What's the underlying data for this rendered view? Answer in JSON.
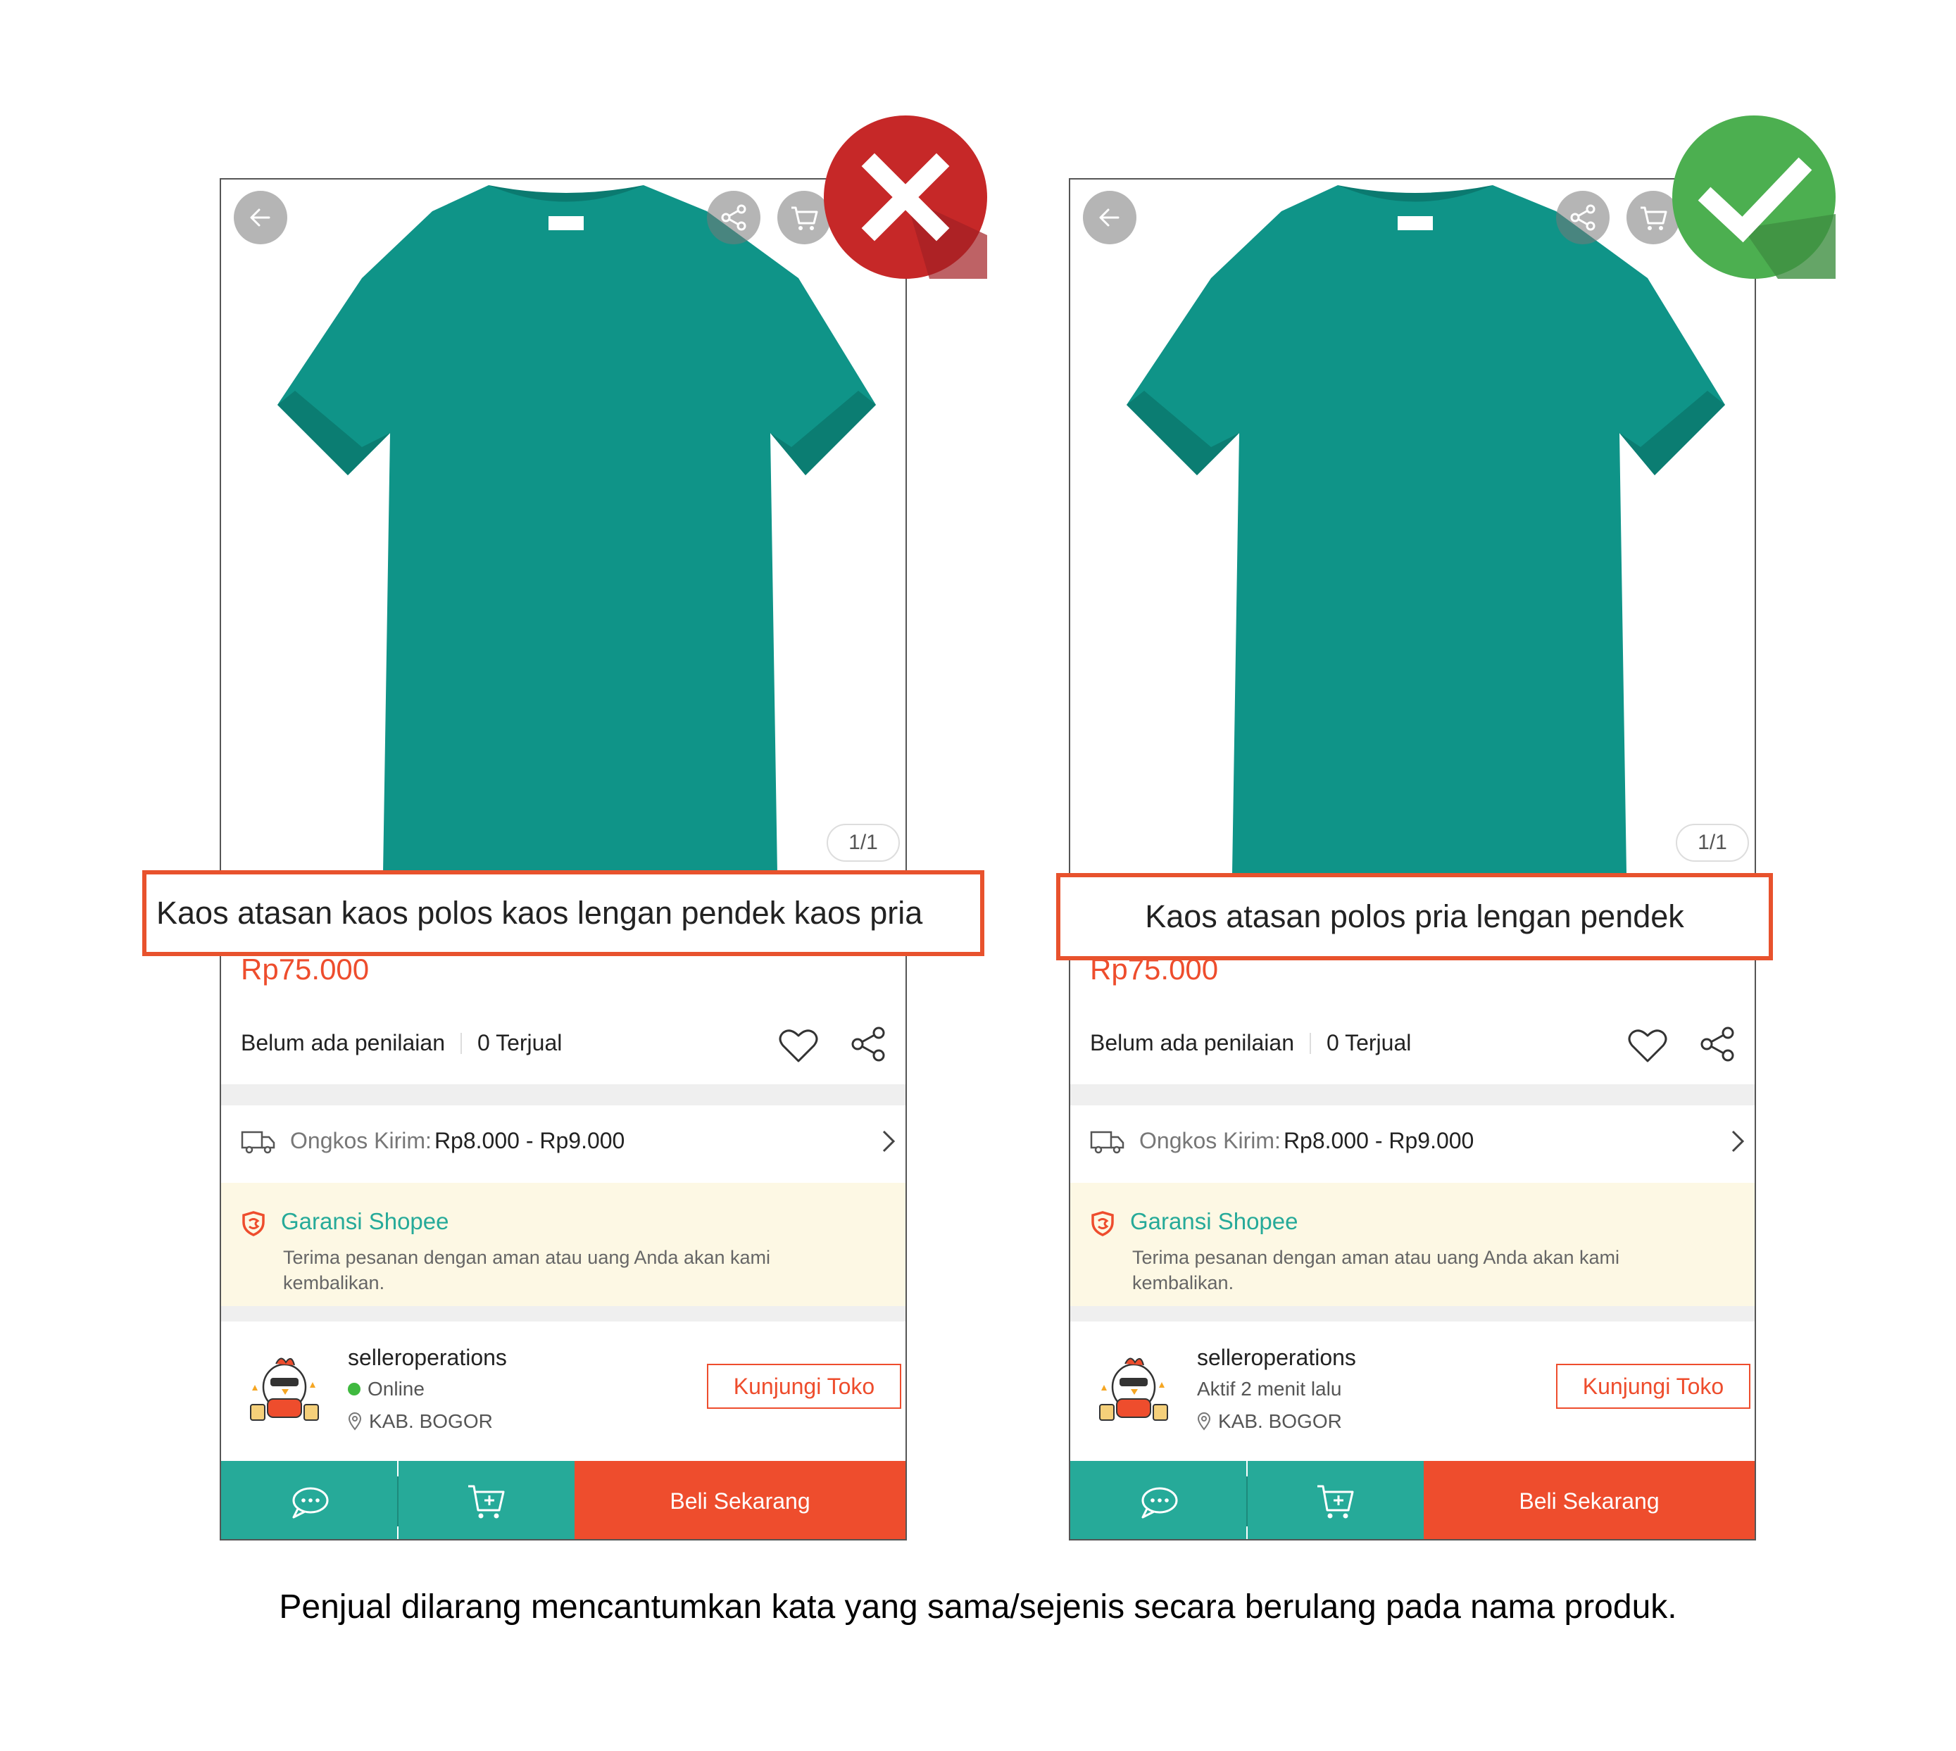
{
  "panels": [
    {
      "verdict": "wrong",
      "image_counter": "1/1",
      "product_title": "Kaos atasan kaos polos kaos lengan pendek kaos pria",
      "price": "Rp75.000",
      "rating_text": "Belum ada penilaian",
      "sold_text": "0 Terjual",
      "shipping_label": "Ongkos Kirim:",
      "shipping_value": "Rp8.000 - Rp9.000",
      "guarantee_title": "Garansi Shopee",
      "guarantee_text": "Terima pesanan dengan aman atau uang Anda akan kami kembalikan.",
      "shop_name": "selleroperations",
      "shop_status": "Online",
      "shop_location": "KAB. BOGOR",
      "visit_button": "Kunjungi Toko",
      "buy_button": "Beli Sekarang"
    },
    {
      "verdict": "correct",
      "image_counter": "1/1",
      "product_title": "Kaos atasan polos pria lengan pendek",
      "price": "Rp75.000",
      "rating_text": "Belum ada penilaian",
      "sold_text": "0 Terjual",
      "shipping_label": "Ongkos Kirim:",
      "shipping_value": "Rp8.000 - Rp9.000",
      "guarantee_title": "Garansi Shopee",
      "guarantee_text": "Terima pesanan dengan aman atau uang Anda akan kami kembalikan.",
      "shop_name": "selleroperations",
      "shop_status": "Aktif 2 menit lalu",
      "shop_location": "KAB. BOGOR",
      "visit_button": "Kunjungi Toko",
      "buy_button": "Beli Sekarang"
    }
  ],
  "caption": "Penjual dilarang mencantumkan kata yang sama/sejenis secara berulang pada nama produk.",
  "colors": {
    "accent_orange": "#ee4d2d",
    "teal": "#26aa99",
    "shirt": "#0f9488",
    "wrong_badge": "#c62828",
    "correct_badge": "#4caf50"
  },
  "icons": [
    "back-arrow-icon",
    "share-icon",
    "cart-icon",
    "heart-icon",
    "truck-icon",
    "shield-icon",
    "location-pin-icon",
    "chat-icon",
    "add-to-cart-icon",
    "cross-icon",
    "check-icon"
  ]
}
